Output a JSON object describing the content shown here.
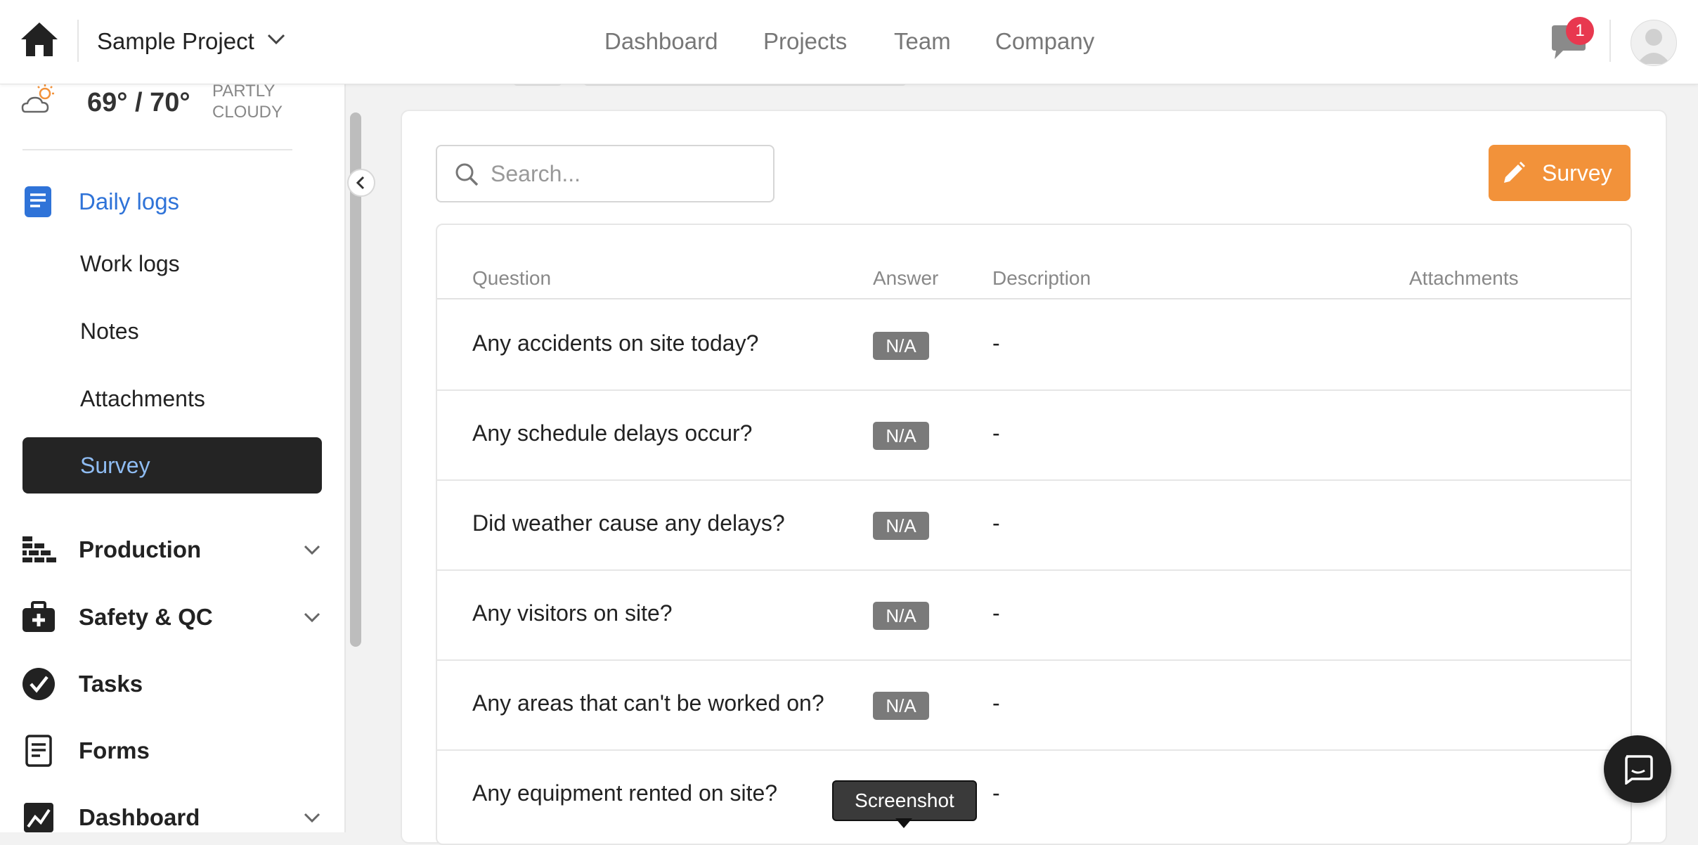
{
  "header": {
    "project_name": "Sample Project",
    "nav": [
      "Dashboard",
      "Projects",
      "Team",
      "Company"
    ],
    "notification_count": "1"
  },
  "sidebar": {
    "weather": {
      "temp": "69° / 70°",
      "condition": "PARTLY CLOUDY"
    },
    "daily_logs": {
      "label": "Daily logs",
      "items": [
        "Work logs",
        "Notes",
        "Attachments",
        "Survey"
      ],
      "active": "Survey"
    },
    "sections": [
      "Production",
      "Safety & QC",
      "Tasks",
      "Forms",
      "Dashboard"
    ]
  },
  "main": {
    "search_placeholder": "Search...",
    "survey_button": "Survey",
    "columns": [
      "Question",
      "Answer",
      "Description",
      "Attachments"
    ],
    "rows": [
      {
        "question": "Any accidents on site today?",
        "answer": "N/A",
        "description": "-"
      },
      {
        "question": "Any schedule delays occur?",
        "answer": "N/A",
        "description": "-"
      },
      {
        "question": "Did weather cause any delays?",
        "answer": "N/A",
        "description": "-"
      },
      {
        "question": "Any visitors on site?",
        "answer": "N/A",
        "description": "-"
      },
      {
        "question": "Any areas that can't be worked on?",
        "answer": "N/A",
        "description": "-"
      },
      {
        "question": "Any equipment rented on site?",
        "answer": "",
        "description": "-"
      }
    ]
  },
  "tooltip": "Screenshot",
  "colors": {
    "accent_orange": "#f2923a",
    "link_blue": "#2f73d8",
    "badge_red": "#e8384f"
  }
}
